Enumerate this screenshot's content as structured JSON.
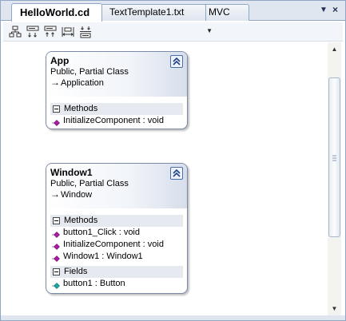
{
  "tabs": [
    {
      "label": "HelloWorld.cd",
      "active": true
    },
    {
      "label": "TextTemplate1.txt",
      "active": false
    },
    {
      "label": "MVC",
      "active": false
    }
  ],
  "tab_controls": {
    "dropdown_icon": "chevron-down-icon",
    "close_icon": "close-icon"
  },
  "toolbar": {
    "buttons": [
      "display-name-icon",
      "display-name-and-type-icon",
      "display-full-signature-icon",
      "adjust-width-icon",
      "group-members-icon"
    ],
    "dropdown_value": ""
  },
  "shapes": [
    {
      "name": "App",
      "modifiers": "Public, Partial Class",
      "base": "Application",
      "compartments": [
        {
          "title": "Methods",
          "members": [
            {
              "text": "InitializeComponent : void",
              "icon": "method-icon"
            }
          ]
        }
      ]
    },
    {
      "name": "Window1",
      "modifiers": "Public, Partial Class",
      "base": "Window",
      "compartments": [
        {
          "title": "Methods",
          "members": [
            {
              "text": "button1_Click : void",
              "icon": "method-icon"
            },
            {
              "text": "InitializeComponent : void",
              "icon": "method-icon"
            },
            {
              "text": "Window1 : Window1",
              "icon": "method-icon"
            }
          ]
        },
        {
          "title": "Fields",
          "members": [
            {
              "text": "button1 : Button",
              "icon": "field-icon"
            }
          ]
        }
      ]
    }
  ],
  "colors": {
    "accent": "#4a6ea8",
    "method": "#b01aa8",
    "field": "#1aa8a8"
  }
}
